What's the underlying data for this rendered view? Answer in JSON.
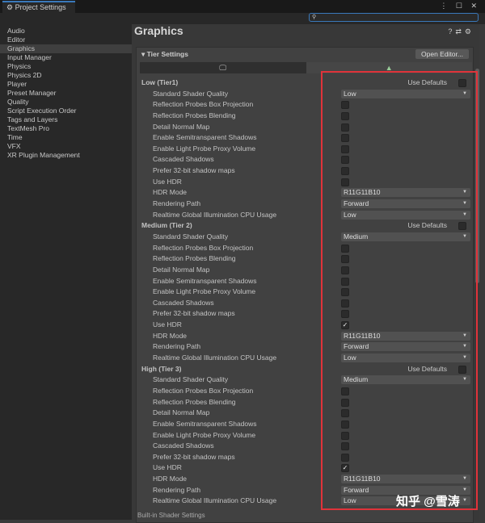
{
  "window": {
    "title": "Project Settings",
    "controls": "⋮ ☐ ✕"
  },
  "search": {
    "placeholder": "",
    "icon": "search-icon"
  },
  "sidebar": {
    "items": [
      "Audio",
      "Editor",
      "Graphics",
      "Input Manager",
      "Physics",
      "Physics 2D",
      "Player",
      "Preset Manager",
      "Quality",
      "Script Execution Order",
      "Tags and Layers",
      "TextMesh Pro",
      "Time",
      "VFX",
      "XR Plugin Management"
    ],
    "selected": "Graphics"
  },
  "main": {
    "title": "Graphics",
    "section": "Tier Settings",
    "open_editor": "Open Editor...",
    "platform_tabs": [
      "standalone-icon",
      "android-icon"
    ],
    "use_defaults_label": "Use Defaults",
    "footer": "Built-in Shader Settings"
  },
  "labels": {
    "shader_quality": "Standard Shader Quality",
    "box_proj": "Reflection Probes Box Projection",
    "blending": "Reflection Probes Blending",
    "detail_normal": "Detail Normal Map",
    "semi_shadows": "Enable Semitransparent Shadows",
    "lppv": "Enable Light Probe Proxy Volume",
    "cascaded": "Cascaded Shadows",
    "prefer32": "Prefer 32-bit shadow maps",
    "use_hdr": "Use HDR",
    "hdr_mode": "HDR Mode",
    "rendering_path": "Rendering Path",
    "gi_cpu": "Realtime Global Illumination CPU Usage"
  },
  "tiers": [
    {
      "name": "Low (Tier1)",
      "use_defaults": false,
      "shader_quality": "Low",
      "box_proj": false,
      "blending": false,
      "detail_normal": false,
      "semi_shadows": false,
      "lppv": false,
      "cascaded": false,
      "prefer32": false,
      "use_hdr": false,
      "hdr_mode": "R11G11B10",
      "rendering_path": "Forward",
      "gi_cpu": "Low"
    },
    {
      "name": "Medium (Tier 2)",
      "use_defaults": false,
      "shader_quality": "Medium",
      "box_proj": false,
      "blending": false,
      "detail_normal": false,
      "semi_shadows": false,
      "lppv": false,
      "cascaded": false,
      "prefer32": false,
      "use_hdr": true,
      "hdr_mode": "R11G11B10",
      "rendering_path": "Forward",
      "gi_cpu": "Low"
    },
    {
      "name": "High (Tier 3)",
      "use_defaults": false,
      "shader_quality": "Medium",
      "box_proj": false,
      "blending": false,
      "detail_normal": false,
      "semi_shadows": false,
      "lppv": false,
      "cascaded": false,
      "prefer32": false,
      "use_hdr": true,
      "hdr_mode": "R11G11B10",
      "rendering_path": "Forward",
      "gi_cpu": "Low"
    }
  ],
  "watermark": "知乎 @雪涛",
  "colors": {
    "highlight": "#e0333a",
    "accent": "#3a79bb"
  }
}
